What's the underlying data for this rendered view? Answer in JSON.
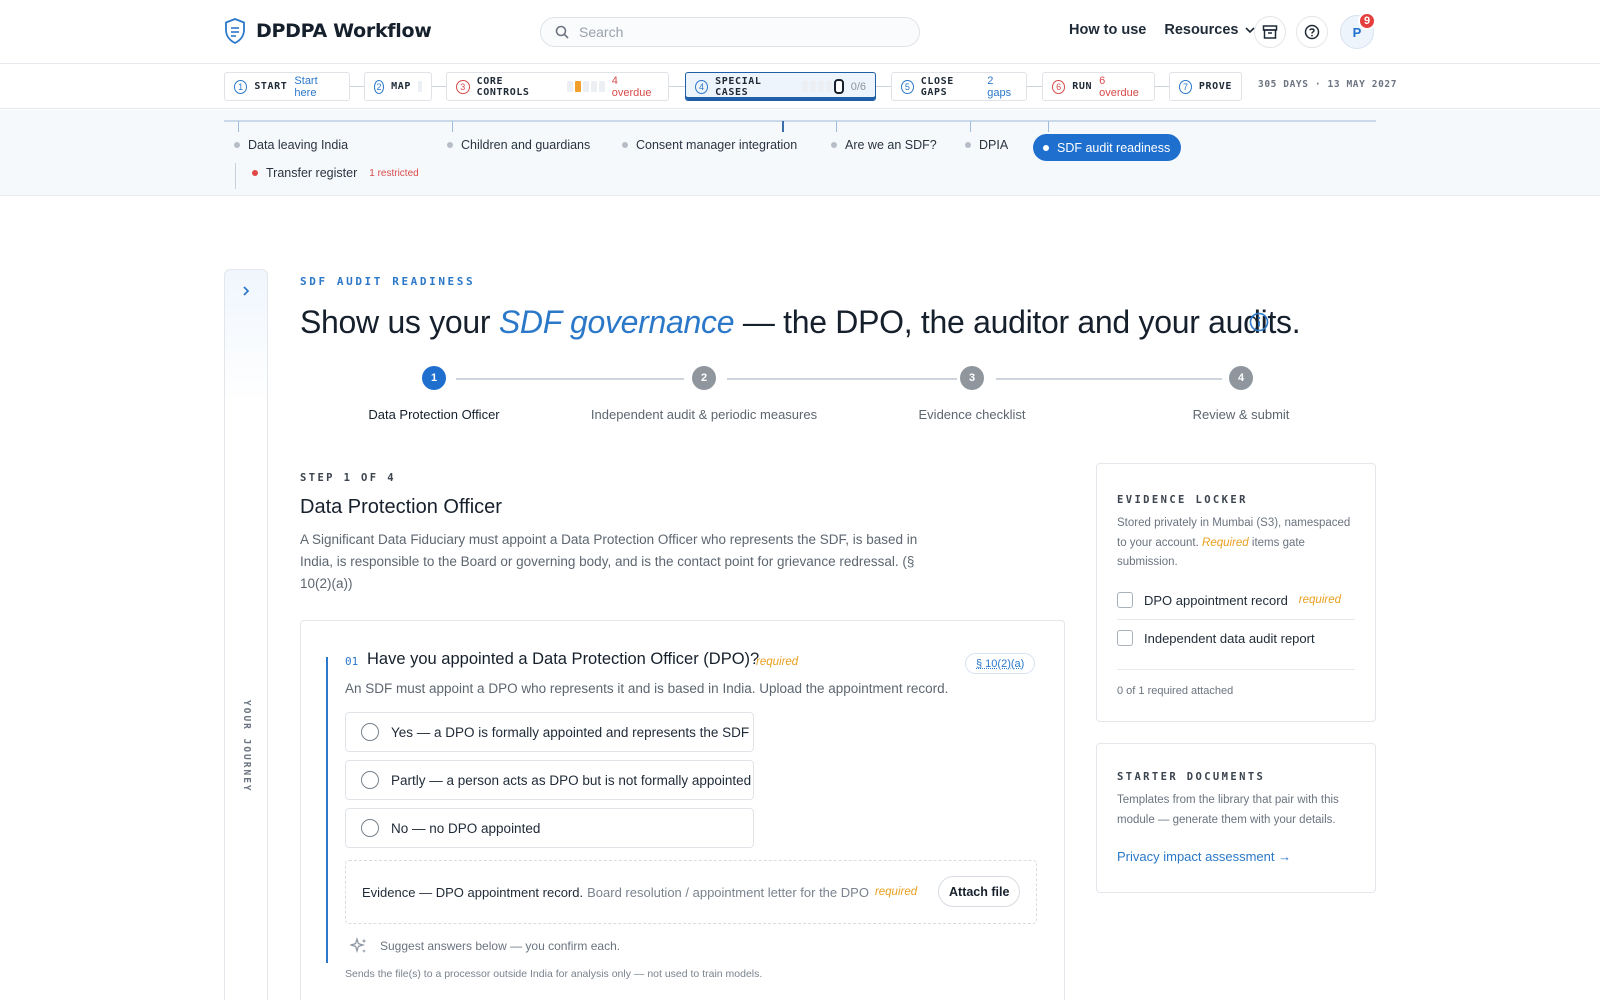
{
  "header": {
    "app_name": "DPDPA Workflow",
    "search_placeholder": "Search",
    "how_to_use": "How to use",
    "resources": "Resources",
    "avatar_initial": "P",
    "notification_count": "9",
    "icons": [
      "shield-icon",
      "search-icon",
      "chevron-down-icon",
      "archive-icon",
      "help-icon"
    ]
  },
  "phases": [
    {
      "num": "1",
      "label": "START",
      "sub": "Start here"
    },
    {
      "num": "2",
      "label": "MAP",
      "sub": ""
    },
    {
      "num": "3",
      "label": "CORE CONTROLS",
      "sub": "4 overdue"
    },
    {
      "num": "4",
      "label": "SPECIAL CASES",
      "sub": "0/6"
    },
    {
      "num": "5",
      "label": "CLOSE GAPS",
      "sub": "2 gaps"
    },
    {
      "num": "6",
      "label": "RUN",
      "sub": "6 overdue"
    },
    {
      "num": "7",
      "label": "PROVE",
      "sub": ""
    }
  ],
  "deadline": "305 DAYS · 13 MAY 2027",
  "subnav": {
    "items": [
      {
        "label": "Data leaving India"
      },
      {
        "label": "Children and guardians"
      },
      {
        "label": "Consent manager integration"
      },
      {
        "label": "Are we an SDF?"
      },
      {
        "label": "DPIA"
      },
      {
        "label": "SDF audit readiness"
      }
    ],
    "child": {
      "label": "Transfer register",
      "badge": "1 restricted"
    }
  },
  "rail": {
    "label": "YOUR JOURNEY"
  },
  "page": {
    "eyebrow": "SDF AUDIT READINESS",
    "headline_pre": "Show us your ",
    "headline_em": "SDF governance",
    "headline_post": " — the DPO, the auditor and your audits."
  },
  "wizard": {
    "steps": [
      {
        "num": "1",
        "label": "Data Protection Officer"
      },
      {
        "num": "2",
        "label": "Independent audit & periodic measures"
      },
      {
        "num": "3",
        "label": "Evidence checklist"
      },
      {
        "num": "4",
        "label": "Review & submit"
      }
    ],
    "active": 1
  },
  "step": {
    "eyebrow": "STEP 1 OF 4",
    "title": "Data Protection Officer",
    "description": "A Significant Data Fiduciary must appoint a Data Protection Officer who represents the SDF, is based in India, is responsible to the Board or governing body, and is the contact point for grievance redressal. (§ 10(2)(a))"
  },
  "question": {
    "number": "01",
    "title": "Have you appointed a Data Protection Officer (DPO)?",
    "required": "required",
    "section": "§ 10(2)(a)",
    "description": "An SDF must appoint a DPO who represents it and is based in India. Upload the appointment record.",
    "options": [
      "Yes — a DPO is formally appointed and represents the SDF",
      "Partly — a person acts as DPO but is not formally appointed",
      "No — no DPO appointed"
    ],
    "evidence": {
      "title": "Evidence — DPO appointment record.",
      "hint": "Board resolution / appointment letter for the DPO",
      "required": "required",
      "attach": "Attach file"
    },
    "suggest": "Suggest answers below — you confirm each.",
    "footnote": "Sends the file(s) to a processor outside India for analysis only — not used to train models."
  },
  "evidence_locker": {
    "title": "EVIDENCE LOCKER",
    "desc_pre": "Stored privately in Mumbai (S3), namespaced to your account. ",
    "desc_req": "Required",
    "desc_post": " items gate submission.",
    "items": [
      {
        "label": "DPO appointment record",
        "required": "required"
      },
      {
        "label": "Independent data audit report",
        "required": ""
      }
    ],
    "summary": "0 of 1 required attached"
  },
  "starter_docs": {
    "title": "STARTER DOCUMENTS",
    "desc": "Templates from the library that pair with this module — generate them with your details.",
    "link": "Privacy impact assessment →"
  },
  "colors": {
    "accent": "#2b78c9",
    "active": "#1f6fcf",
    "required": "#e8a021",
    "alert": "#d94b4b"
  }
}
